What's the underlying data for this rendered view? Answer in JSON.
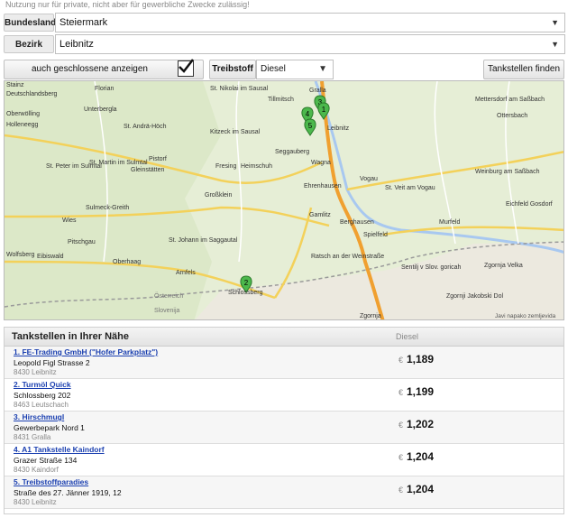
{
  "notice": "Nutzung nur für private, nicht aber für gewerbliche Zwecke zulässig!",
  "filters": {
    "bundesland_label": "Bundesland",
    "bundesland_value": "Steiermark",
    "bezirk_label": "Bezirk",
    "bezirk_value": "Leibnitz",
    "closed_label": "auch geschlossene anzeigen",
    "closed_checked": true,
    "fuel_label": "Treibstoff",
    "fuel_value": "Diesel",
    "search_label": "Tankstellen finden"
  },
  "map": {
    "attribution": "Javi napako zemljevida",
    "places": [
      "Stainz",
      "Florian",
      "Deutschlandsberg",
      "Unterbergla",
      "St. Nikolai im Sausal",
      "Tillmitsch",
      "Gralla",
      "Leibnitz",
      "Mettersdorf am Saßbach",
      "St. Andrä-Höch",
      "Kitzeck im Sausal",
      "St. Peter im Sulmtal",
      "Gleinstätten",
      "Pistorf",
      "Seggauberg",
      "Wagna",
      "Ehrenhausen",
      "Vogau",
      "St. Veit am Vogau",
      "Weinburg am Saßbach",
      "Sulmeck-Greith",
      "Großklein",
      "Gamlitz",
      "Berghausen",
      "Murfeld",
      "Wies",
      "Pitschgau",
      "St. Johann im Saggautal",
      "Spielfeld",
      "Eichfeld Gosdorf",
      "Eibiswald",
      "Oberhaag",
      "Arnfels",
      "Schlossberg",
      "Ratsch an der Weinstraße",
      "Ottersbach",
      "Zgornja Velka",
      "Sentilj v Slov. goricah",
      "Zgornji Jakobski Dol",
      "Zgornja",
      "Oberwölling",
      "Holleneegg",
      "St. Martin im Sulmtal",
      "Heimschuh",
      "Fresing",
      "Österreich",
      "Slovenija",
      "Wolfsberg"
    ],
    "markers": [
      "1",
      "2",
      "3",
      "4",
      "5"
    ]
  },
  "results": {
    "title": "Tankstellen in Ihrer Nähe",
    "column": "Diesel",
    "currency": "€",
    "items": [
      {
        "name": "1. FE-Trading GmbH (\"Hofer Parkplatz\")",
        "street": "Leopold Figl Strasse 2",
        "city": "8430 Leibnitz",
        "price": "1,189"
      },
      {
        "name": "2. Turmöl Quick",
        "street": "Schlossberg 202",
        "city": "8463 Leutschach",
        "price": "1,199"
      },
      {
        "name": "3. Hirschmugl",
        "street": "Gewerbepark Nord 1",
        "city": "8431 Gralla",
        "price": "1,202"
      },
      {
        "name": "4. A1 Tankstelle Kaindorf",
        "street": "Grazer Straße 134",
        "city": "8430 Kaindorf",
        "price": "1,204"
      },
      {
        "name": "5. Treibstoffparadies",
        "street": "Straße des 27. Jänner 1919, 12",
        "city": "8430 Leibnitz",
        "price": "1,204"
      }
    ]
  }
}
